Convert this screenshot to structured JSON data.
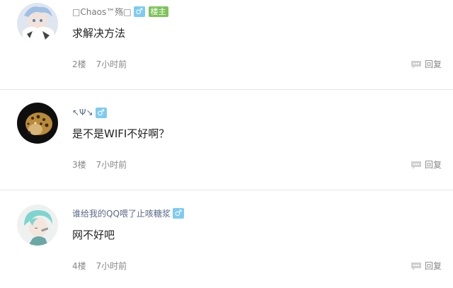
{
  "posts": [
    {
      "username": "□Chaos™殇□",
      "gender_symbol": "♂",
      "host_tag": "楼主",
      "content": "求解决方法",
      "floor": "2楼",
      "time": "7小时前",
      "reply_label": "回复"
    },
    {
      "username": "↖Ψ↘",
      "gender_symbol": "♂",
      "content": "是不是WIFI不好啊？",
      "floor": "3楼",
      "time": "7小时前",
      "reply_label": "回复"
    },
    {
      "username": "谁给我的QQ喂了止咳糖浆",
      "gender_symbol": "♂",
      "content": "网不好吧",
      "floor": "4楼",
      "time": "7小时前",
      "reply_label": "回复"
    }
  ],
  "colors": {
    "gender_badge": "#7ecbf2",
    "host_badge": "#7dc45a",
    "divider": "#e6e6e6"
  }
}
